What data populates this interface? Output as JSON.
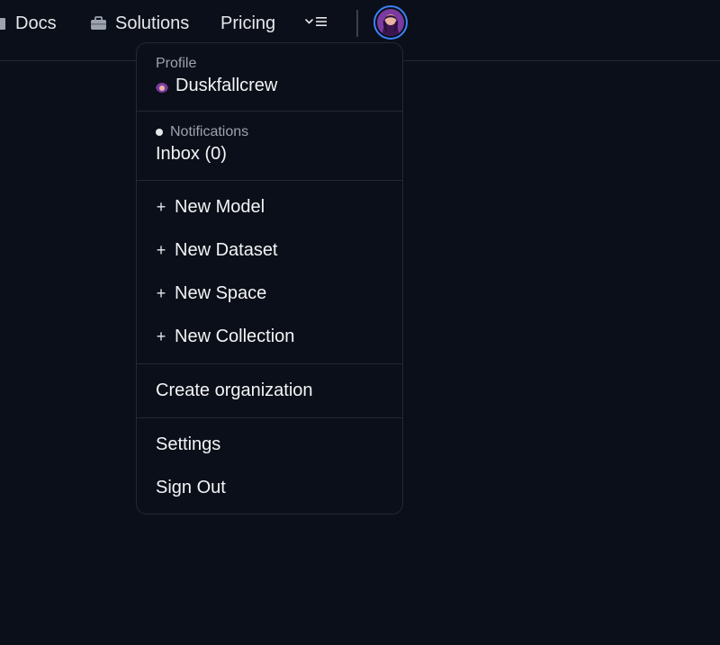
{
  "nav": {
    "items": [
      {
        "label": "Docs",
        "icon": "docs-icon"
      },
      {
        "label": "Solutions",
        "icon": "briefcase-icon"
      },
      {
        "label": "Pricing"
      }
    ],
    "more_icon": "chevron-down-menu-icon"
  },
  "user_menu": {
    "profile_label": "Profile",
    "username": "Duskfallcrew",
    "notifications_label": "Notifications",
    "inbox_label": "Inbox (0)",
    "create_items": [
      {
        "label": "New Model"
      },
      {
        "label": "New Dataset"
      },
      {
        "label": "New Space"
      },
      {
        "label": "New Collection"
      }
    ],
    "create_organization_label": "Create organization",
    "settings_label": "Settings",
    "sign_out_label": "Sign Out"
  },
  "colors": {
    "background": "#0b0f19",
    "border": "#1f2937",
    "avatar_ring": "#3b82f6",
    "muted_text": "#9ca3af",
    "text": "#f3f4f6"
  }
}
